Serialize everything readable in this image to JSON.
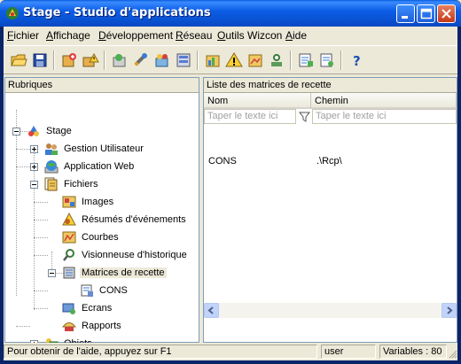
{
  "window": {
    "title": "Stage - Studio d'applications",
    "title_icon": "app-icon"
  },
  "menubar": {
    "items": [
      "Fichier",
      "Affichage",
      "Développement",
      "Réseau",
      "Outils Wizcon",
      "Aide"
    ]
  },
  "toolbar": {
    "buttons": [
      "open-icon",
      "save-icon",
      "new-project-icon",
      "warning-icon",
      "user-icon",
      "tools-icon",
      "build-icon",
      "network-icon",
      "chart-icon",
      "alarm-icon",
      "image-icon",
      "users-icon",
      "screen-icon",
      "export-icon",
      "help-icon"
    ]
  },
  "left_panel": {
    "header": "Rubriques",
    "tree": {
      "root": "Stage",
      "gestion": "Gestion Utilisateur",
      "web": "Application Web",
      "fichiers": "Fichiers",
      "images": "Images",
      "resumes": "Résumés d'événements",
      "courbes": "Courbes",
      "visionneuse": "Visionneuse d'historique",
      "matrices": "Matrices de recette",
      "cons": "CONS",
      "ecrans": "Ecrans",
      "rapports": "Rapports",
      "objets": "Objets"
    }
  },
  "right_panel": {
    "header": "Liste des matrices de recette",
    "columns": [
      "Nom",
      "Chemin"
    ],
    "filter_placeholder": "Taper le texte ici",
    "rows": [
      {
        "nom": "CONS",
        "chemin": ".\\Rcp\\"
      }
    ]
  },
  "statusbar": {
    "help": "Pour obtenir de l'aide, appuyez sur F1",
    "user": "user",
    "variables": "Variables : 80"
  }
}
